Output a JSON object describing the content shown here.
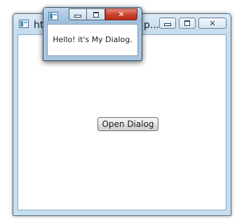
{
  "main_window": {
    "title": "ht",
    "title_tail": "p...",
    "controls": {
      "minimize": "minimize",
      "maximize": "maximize",
      "close": "close"
    },
    "open_dialog_button": {
      "label": "Open Dialog"
    }
  },
  "dialog_window": {
    "message": "Hello! it's My Dialog.",
    "controls": {
      "minimize": "minimize",
      "maximize": "maximize",
      "close": "close"
    }
  },
  "icons": [
    "app-icon",
    "minimize-icon",
    "maximize-icon",
    "close-icon"
  ],
  "colors": {
    "frame_active": "#a8c6e0",
    "frame_inactive": "#c6dff1",
    "close_button": "#c9402d"
  }
}
